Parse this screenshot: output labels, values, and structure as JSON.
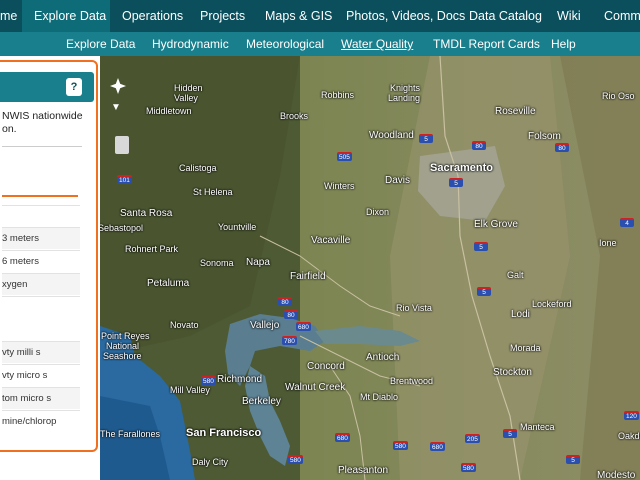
{
  "topnav": {
    "items": [
      {
        "label": "me",
        "active": false
      },
      {
        "label": "Explore Data",
        "active": true
      },
      {
        "label": "Operations",
        "active": false
      },
      {
        "label": "Projects",
        "active": false
      },
      {
        "label": "Maps & GIS",
        "active": false
      },
      {
        "label": "Photos, Videos, Docs",
        "active": false
      },
      {
        "label": "Data Catalog",
        "active": false
      },
      {
        "label": "Wiki",
        "active": false
      },
      {
        "label": "Commu",
        "active": false
      }
    ]
  },
  "subnav": {
    "items": [
      {
        "label": "Explore Data"
      },
      {
        "label": "Hydrodynamic"
      },
      {
        "label": "Meteorological"
      },
      {
        "label": "Water Quality",
        "current": true
      },
      {
        "label": "TMDL Report Cards"
      },
      {
        "label": "Help"
      }
    ]
  },
  "panel": {
    "help_label": "?",
    "description_line1": "NWIS nationwide",
    "description_line2": "on.",
    "params": [
      "",
      "3 meters",
      "6 meters",
      "xygen",
      "",
      "vty milli s",
      "vty micro s",
      "tom micro s",
      "mine/chlorop"
    ]
  },
  "map": {
    "labels": [
      {
        "text": "Hidden",
        "size": ""
      },
      {
        "text": "Valley",
        "size": ""
      },
      {
        "text": "Middletown",
        "size": ""
      },
      {
        "text": "Brooks",
        "size": ""
      },
      {
        "text": "Knights",
        "size": ""
      },
      {
        "text": "Landing",
        "size": ""
      },
      {
        "text": "Robbins",
        "size": ""
      },
      {
        "text": "Rio Oso",
        "size": ""
      },
      {
        "text": "Roseville",
        "size": ""
      },
      {
        "text": "Woodland",
        "size": "med"
      },
      {
        "text": "Folsom",
        "size": "med"
      },
      {
        "text": "Calistoga",
        "size": ""
      },
      {
        "text": "Winters",
        "size": ""
      },
      {
        "text": "Davis",
        "size": "med"
      },
      {
        "text": "Sacramento",
        "size": "big"
      },
      {
        "text": "St Helena",
        "size": ""
      },
      {
        "text": "Santa Rosa",
        "size": "med"
      },
      {
        "text": "Sebastopol",
        "size": ""
      },
      {
        "text": "Dixon",
        "size": ""
      },
      {
        "text": "Yountville",
        "size": ""
      },
      {
        "text": "Elk Grove",
        "size": "med"
      },
      {
        "text": "Rohnert Park",
        "size": ""
      },
      {
        "text": "Vacaville",
        "size": "med"
      },
      {
        "text": "Sonoma",
        "size": ""
      },
      {
        "text": "Napa",
        "size": "med"
      },
      {
        "text": "Galt",
        "size": ""
      },
      {
        "text": "Ione",
        "size": ""
      },
      {
        "text": "Petaluma",
        "size": "med"
      },
      {
        "text": "Fairfield",
        "size": "med"
      },
      {
        "text": "Rio Vista",
        "size": ""
      },
      {
        "text": "Lockeford",
        "size": ""
      },
      {
        "text": "Lodi",
        "size": "med"
      },
      {
        "text": "Novato",
        "size": ""
      },
      {
        "text": "Vallejo",
        "size": "med"
      },
      {
        "text": "Point Reyes",
        "size": ""
      },
      {
        "text": "National",
        "size": ""
      },
      {
        "text": "Seashore",
        "size": ""
      },
      {
        "text": "Concord",
        "size": "med"
      },
      {
        "text": "Antioch",
        "size": "med"
      },
      {
        "text": "Morada",
        "size": ""
      },
      {
        "text": "Mill Valley",
        "size": ""
      },
      {
        "text": "Richmond",
        "size": "med"
      },
      {
        "text": "Walnut Creek",
        "size": "med"
      },
      {
        "text": "Brentwood",
        "size": ""
      },
      {
        "text": "Stockton",
        "size": "med"
      },
      {
        "text": "Berkeley",
        "size": "med"
      },
      {
        "text": "Mt Diablo",
        "size": ""
      },
      {
        "text": "The Farallones",
        "size": ""
      },
      {
        "text": "San Francisco",
        "size": "big"
      },
      {
        "text": "Manteca",
        "size": ""
      },
      {
        "text": "Oakda",
        "size": ""
      },
      {
        "text": "Daly City",
        "size": ""
      },
      {
        "text": "Pleasanton",
        "size": "med"
      },
      {
        "text": "Modesto",
        "size": "med"
      }
    ],
    "shields": [
      "5",
      "505",
      "80",
      "5",
      "101",
      "80",
      "80",
      "5",
      "5",
      "680",
      "780",
      "80",
      "580",
      "680",
      "580",
      "680",
      "580",
      "205",
      "5",
      "580",
      "5",
      "4",
      "120"
    ]
  },
  "colors": {
    "nav": "#0b4f5c",
    "nav_active": "#0e6b78",
    "subnav": "#1a7f8c",
    "panel_border": "#f07020"
  }
}
